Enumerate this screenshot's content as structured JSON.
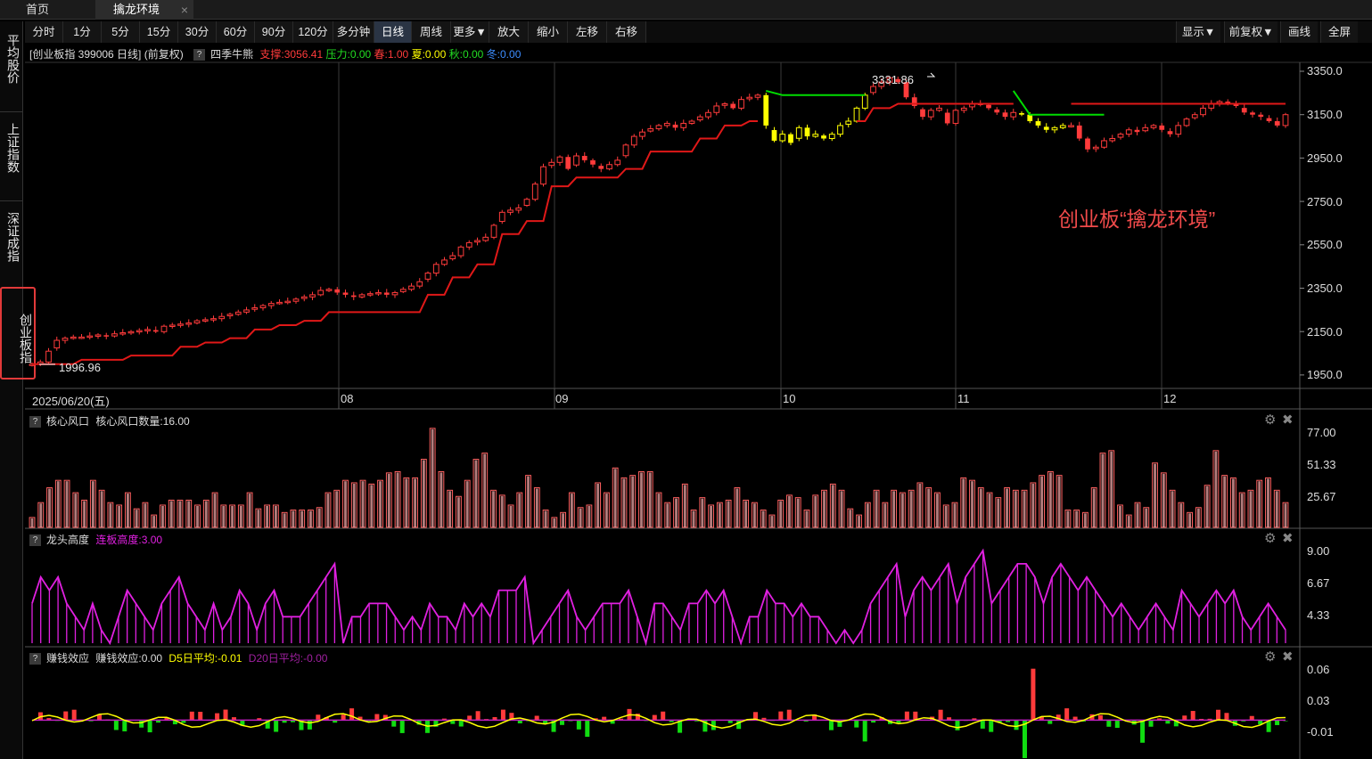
{
  "tabs": {
    "home": "首页",
    "active": "擒龙环境",
    "close": "×"
  },
  "toolbar": {
    "periods": [
      "分时",
      "1分",
      "5分",
      "15分",
      "30分",
      "60分",
      "90分",
      "120分",
      "多分钟",
      "日线",
      "周线",
      "更多▼",
      "放大",
      "缩小",
      "左移",
      "右移"
    ],
    "selected": "日线",
    "right": [
      "显示▼",
      "前复权▼",
      "画线",
      "全屏"
    ]
  },
  "sidebar": [
    "平均股价",
    "上证指数",
    "深证成指",
    "创业板指"
  ],
  "sidebar_selected": "创业板指",
  "main": {
    "title": "[创业板指 399006 日线] (前复权)",
    "indicator_q": "?",
    "indicator": "四季牛熊",
    "support": "支撑:3056.41",
    "pressure": "压力:0.00",
    "spring": "春:1.00",
    "summer": "夏:0.00",
    "autumn": "秋:0.00",
    "winter": "冬:0.00",
    "high_label": "3331.86",
    "low_label": "1996.96",
    "annotation": "创业板“擒龙环境”",
    "y_ticks": [
      "3350.0",
      "3150.0",
      "2950.0",
      "2750.0",
      "2550.0",
      "2350.0",
      "2150.0",
      "1950.0"
    ],
    "date_first": "2025/06/20(五)",
    "months": [
      "08",
      "09",
      "10",
      "11",
      "12"
    ]
  },
  "panel1": {
    "q": "?",
    "name": "核心风口",
    "value": "核心风口数量:16.00",
    "y_ticks": [
      "77.00",
      "51.33",
      "25.67"
    ]
  },
  "panel2": {
    "q": "?",
    "name": "龙头高度",
    "value": "连板高度:3.00",
    "y_ticks": [
      "9.00",
      "6.67",
      "4.33"
    ]
  },
  "panel3": {
    "q": "?",
    "name": "赚钱效应",
    "value": "赚钱效应:0.00",
    "d5": "D5日平均:-0.01",
    "d20": "D20日平均:-0.00",
    "y_ticks": [
      "0.06",
      "0.03",
      "-0.01"
    ]
  },
  "colors": {
    "up": "#ff3b3b",
    "down": "#ffff00",
    "support_line": "#e01818",
    "pressure_line": "#00dd00",
    "height_line": "#e020e0",
    "d5": "#ffff00",
    "d20": "#c020c0"
  },
  "chart_data": [
    {
      "type": "candlestick",
      "title": "创业板指 399006 日线",
      "ylim": [
        1950,
        3350
      ],
      "x_months": [
        "08",
        "09",
        "10",
        "11",
        "12"
      ],
      "close": [
        2000,
        2010,
        2060,
        2110,
        2120,
        2125,
        2125,
        2130,
        2135,
        2130,
        2140,
        2145,
        2150,
        2155,
        2160,
        2150,
        2175,
        2180,
        2185,
        2190,
        2200,
        2205,
        2210,
        2220,
        2230,
        2240,
        2250,
        2260,
        2270,
        2280,
        2285,
        2290,
        2300,
        2310,
        2320,
        2340,
        2345,
        2330,
        2320,
        2310,
        2320,
        2325,
        2330,
        2320,
        2330,
        2345,
        2360,
        2380,
        2420,
        2460,
        2480,
        2500,
        2540,
        2560,
        2570,
        2585,
        2640,
        2700,
        2710,
        2720,
        2760,
        2830,
        2910,
        2930,
        2955,
        2900,
        2960,
        2940,
        2920,
        2900,
        2920,
        2940,
        3010,
        3050,
        3070,
        3085,
        3100,
        3110,
        3090,
        3110,
        3120,
        3140,
        3160,
        3190,
        3200,
        3180,
        3220,
        3230,
        3240,
        3100,
        3030,
        3060,
        3020,
        3090,
        3050,
        3060,
        3040,
        3060,
        3100,
        3120,
        3180,
        3240,
        3280,
        3300,
        3320,
        3300,
        3230,
        3190,
        3140,
        3170,
        3180,
        3110,
        3170,
        3180,
        3200,
        3195,
        3180,
        3160,
        3140,
        3160,
        3150,
        3120,
        3100,
        3080,
        3090,
        3100,
        3100,
        3040,
        2990,
        3000,
        3030,
        3040,
        3060,
        3080,
        3070,
        3090,
        3100,
        3080,
        3060,
        3100,
        3130,
        3150,
        3180,
        3200,
        3210,
        3200,
        3190,
        3160,
        3150,
        3140,
        3120,
        3100,
        3150
      ]
    },
    {
      "type": "bar",
      "name": "核心风口",
      "ylim": [
        0,
        85
      ],
      "values": [
        8,
        20,
        32,
        38,
        38,
        28,
        22,
        38,
        30,
        20,
        18,
        28,
        15,
        20,
        10,
        18,
        22,
        22,
        22,
        18,
        22,
        28,
        18,
        18,
        18,
        28,
        15,
        18,
        18,
        12,
        14,
        14,
        14,
        16,
        28,
        30,
        38,
        36,
        38,
        35,
        38,
        44,
        45,
        40,
        40,
        55,
        80,
        45,
        30,
        25,
        38,
        55,
        60,
        30,
        26,
        18,
        28,
        42,
        32,
        14,
        8,
        12,
        28,
        16,
        18,
        36,
        28,
        48,
        40,
        42,
        45,
        45,
        28,
        20,
        24,
        35,
        14,
        24,
        18,
        20,
        22,
        32,
        22,
        20,
        14,
        10,
        22,
        26,
        24,
        14,
        26,
        30,
        35,
        30,
        15,
        10,
        20,
        30,
        20,
        30,
        28,
        30,
        36,
        32,
        28,
        18,
        20,
        40,
        38,
        32,
        28,
        24,
        32,
        30,
        30,
        36,
        42,
        45,
        42,
        14,
        14,
        12,
        32,
        60,
        62,
        18,
        10,
        20,
        16,
        52,
        44,
        30,
        20,
        12,
        16,
        34,
        62,
        42,
        40,
        28,
        30,
        38,
        40,
        30,
        20
      ],
      "last": 16
    },
    {
      "type": "line",
      "name": "龙头高度",
      "ylim": [
        2,
        9.5
      ],
      "values": [
        5,
        7,
        6,
        7,
        5,
        4,
        3,
        5,
        3,
        2,
        4,
        6,
        5,
        4,
        3,
        5,
        6,
        7,
        5,
        4,
        3,
        5,
        3,
        4,
        6,
        5,
        3,
        5,
        6,
        4,
        4,
        4,
        5,
        6,
        7,
        8,
        2,
        4,
        4,
        5,
        5,
        5,
        4,
        3,
        4,
        3,
        5,
        4,
        4,
        3,
        5,
        4,
        5,
        4,
        6,
        6,
        6,
        7,
        2,
        3,
        4,
        5,
        6,
        4,
        3,
        4,
        5,
        5,
        5,
        6,
        4,
        2,
        5,
        5,
        4,
        3,
        5,
        5,
        6,
        5,
        6,
        4,
        2,
        4,
        4,
        6,
        5,
        5,
        4,
        5,
        4,
        4,
        3,
        2,
        3,
        2,
        3,
        5,
        6,
        7,
        8,
        4,
        6,
        7,
        6,
        7,
        8,
        5,
        7,
        8,
        9,
        5,
        6,
        7,
        8,
        8,
        7,
        5,
        7,
        8,
        7,
        6,
        7,
        6,
        5,
        4,
        5,
        4,
        3,
        4,
        5,
        4,
        3,
        6,
        5,
        4,
        5,
        6,
        5,
        6,
        4,
        3,
        4,
        5,
        4,
        3
      ],
      "last": 3
    },
    {
      "type": "bar",
      "name": "赚钱效应",
      "ylim": [
        -0.025,
        0.07
      ],
      "series": [
        {
          "name": "D5日平均",
          "last": -0.01
        },
        {
          "name": "D20日平均",
          "last": -0.0
        }
      ]
    }
  ]
}
